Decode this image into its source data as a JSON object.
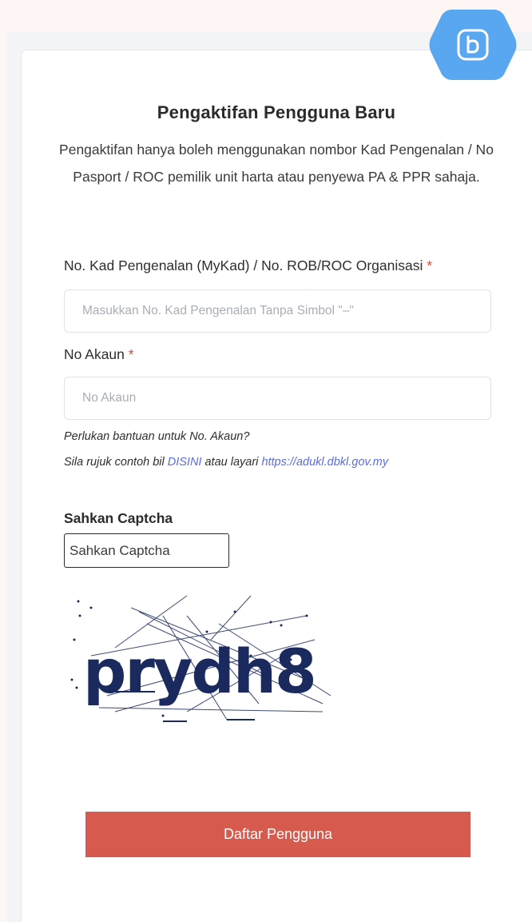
{
  "form": {
    "title": "Pengaktifan Pengguna Baru",
    "subtitle": "Pengaktifan hanya boleh menggunakan nombor Kad Pengenalan / No Pasport / ROC pemilik unit harta atau penyewa PA & PPR sahaja.",
    "required_marker": "*",
    "id_field": {
      "label": "No. Kad Pengenalan (MyKad) / No. ROB/ROC Organisasi",
      "value": "",
      "placeholder": "Masukkan No. Kad Pengenalan Tanpa Simbol \"–\""
    },
    "account_field": {
      "label": "No Akaun",
      "value": "",
      "placeholder": "No Akaun"
    },
    "help": {
      "line1": "Perlukan bantuan untuk No. Akaun?",
      "line2_prefix": "Sila rujuk contoh bil ",
      "link_disini": "DISINI",
      "line2_middle": " atau layari ",
      "link_url": "https://adukl.dbkl.gov.my"
    },
    "captcha": {
      "label": "Sahkan Captcha",
      "placeholder": "Sahkan Captcha",
      "value": "",
      "image_text": "prydh8"
    },
    "submit_label": "Daftar Pengguna"
  },
  "badge": {
    "icon": "b-letter-icon",
    "color": "#5aa7f1"
  },
  "colors": {
    "accent": "#d65a4e",
    "link": "#5b6ee1",
    "required": "#d64a3c",
    "captcha_text": "#1a2a5e"
  }
}
